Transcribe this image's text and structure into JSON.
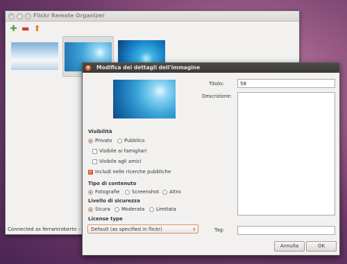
{
  "main_window": {
    "title": "Flickr Remote Organizer",
    "status": "Connected as ferramroberto - 3("
  },
  "dialog": {
    "title": "Modifica dei dettagli dell'immagine",
    "visibility": {
      "heading": "Visibilità",
      "private": "Privato",
      "public": "Pubblico",
      "family": "Visibile ai famigliari",
      "friends": "Visibile agli amici",
      "search": "Includi nelle ricerche pubbliche"
    },
    "content_type": {
      "heading": "Tipo di contenuto",
      "photos": "Fotografie",
      "screenshot": "Screenshot",
      "other": "Altro"
    },
    "safety": {
      "heading": "Livello di sicurezza",
      "safe": "Sicura",
      "moderate": "Moderata",
      "restricted": "Limitata"
    },
    "license": {
      "heading": "License type",
      "selected": "Default (as specified in flickr)"
    },
    "fields": {
      "title_label": "Titolo:",
      "title_value": "58",
      "description_label": "Descrizione:",
      "tag_label": "Tag:",
      "tag_value": ""
    },
    "buttons": {
      "cancel": "Annulla",
      "ok": "OK"
    }
  },
  "colors": {
    "accent": "#e0612a",
    "dialog_titlebar": "#3b3a36"
  }
}
